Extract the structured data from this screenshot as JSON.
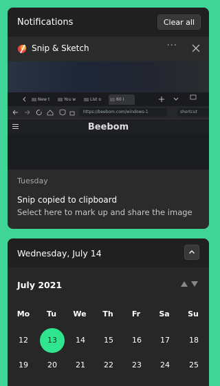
{
  "notifications": {
    "title": "Notifications",
    "clear_all_label": "Clear all",
    "card": {
      "app_name": "Snip & Sketch",
      "more_label": "···",
      "screenshot": {
        "tabs": [
          "New t",
          "You w",
          "List o",
          "60 I"
        ],
        "url": "https://beebom.com/windows-1",
        "find_text": "shortcut",
        "site_title": "Beebom"
      },
      "day": "Tuesday",
      "message_title": "Snip copied to clipboard",
      "message_body": "Select here to mark up and share the image"
    }
  },
  "calendar": {
    "date_header": "Wednesday, July 14",
    "month_label": "July 2021",
    "weekdays": [
      "Mo",
      "Tu",
      "We",
      "Th",
      "Fr",
      "Sa",
      "Su"
    ],
    "week1": [
      "12",
      "13",
      "14",
      "15",
      "16",
      "17",
      "18"
    ],
    "week2": [
      "19",
      "20",
      "21",
      "22",
      "23",
      "24",
      "25"
    ],
    "today": "13",
    "accent_color": "#2fe58e"
  }
}
